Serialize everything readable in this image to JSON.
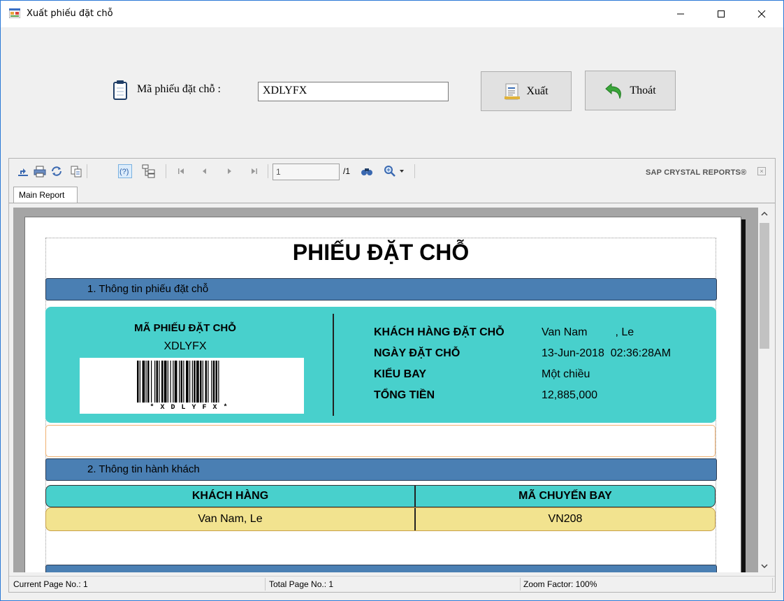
{
  "window": {
    "title": "Xuất phiếu đặt chỗ",
    "controls": [
      "minimize-icon",
      "maximize-icon",
      "close-icon"
    ]
  },
  "form": {
    "label": "Mã phiếu đặt chỗ :",
    "input_value": "XDLYFX",
    "export_button": "Xuất",
    "exit_button": "Thoát"
  },
  "viewer": {
    "toolbar_icons": [
      "export-icon",
      "print-icon",
      "refresh-icon",
      "copy-icon",
      "help-icon",
      "group-tree-icon",
      "first-page-icon",
      "prev-page-icon",
      "next-page-icon",
      "last-page-icon",
      "find-icon",
      "zoom-icon"
    ],
    "page_input": "1",
    "page_total": "/1",
    "brand": "SAP CRYSTAL REPORTS®",
    "tab_label": "Main Report"
  },
  "report": {
    "title": "PHIẾU ĐẶT CHỖ",
    "section1": "1. Thông tin phiếu đặt chỗ",
    "section2": "2. Thông tin hành khách",
    "booking_code_label": "MÃ PHIẾU ĐẶT CHỖ",
    "booking_code_value": "XDLYFX",
    "barcode_text": "*XDLYFX*",
    "details": [
      {
        "label": "KHÁCH HÀNG ĐẶT CHỖ",
        "value": "Van Nam         , Le"
      },
      {
        "label": "NGÀY ĐẶT CHỖ",
        "value": "13-Jun-2018  02:36:28AM"
      },
      {
        "label": "KIỂU BAY",
        "value": "Một chiều"
      },
      {
        "label": "TỔNG TIỀN",
        "value": "12,885,000"
      }
    ],
    "passenger_table": {
      "headers": [
        "KHÁCH HÀNG",
        "MÃ CHUYẾN BAY"
      ],
      "rows": [
        [
          "Van Nam, Le",
          "VN208"
        ]
      ]
    }
  },
  "status": {
    "current_page": "Current Page No.: 1",
    "total_page": "Total Page No.: 1",
    "zoom": "Zoom Factor: 100%"
  },
  "colors": {
    "section_bar": "#4a7fb3",
    "info_box": "#48d0cc",
    "table_row": "#f2e38f",
    "window_border": "#2b79d6"
  }
}
